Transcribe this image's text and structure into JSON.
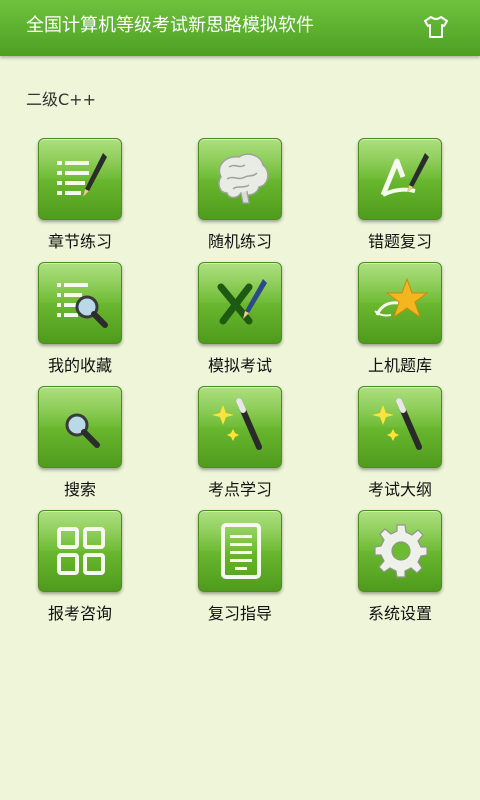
{
  "header": {
    "title": "全国计算机等级考试新思路模拟软件",
    "theme_icon": "shirt-icon"
  },
  "section": {
    "title": "二级C++"
  },
  "menu": [
    {
      "label": "章节练习",
      "icon": "chapter-list-pen-icon"
    },
    {
      "label": "随机练习",
      "icon": "brain-icon"
    },
    {
      "label": "错题复习",
      "icon": "review-pen-icon"
    },
    {
      "label": "我的收藏",
      "icon": "list-magnifier-icon"
    },
    {
      "label": "模拟考试",
      "icon": "x-pen-icon"
    },
    {
      "label": "上机题库",
      "icon": "star-icon"
    },
    {
      "label": "搜索",
      "icon": "search-icon"
    },
    {
      "label": "考点学习",
      "icon": "magic-wand-icon"
    },
    {
      "label": "考试大纲",
      "icon": "magic-wand-icon"
    },
    {
      "label": "报考咨询",
      "icon": "grid-icon"
    },
    {
      "label": "复习指导",
      "icon": "document-icon"
    },
    {
      "label": "系统设置",
      "icon": "gear-icon"
    }
  ],
  "colors": {
    "header": "#5aad2b",
    "background": "#eef5d8",
    "tile": "#6cbb30"
  }
}
